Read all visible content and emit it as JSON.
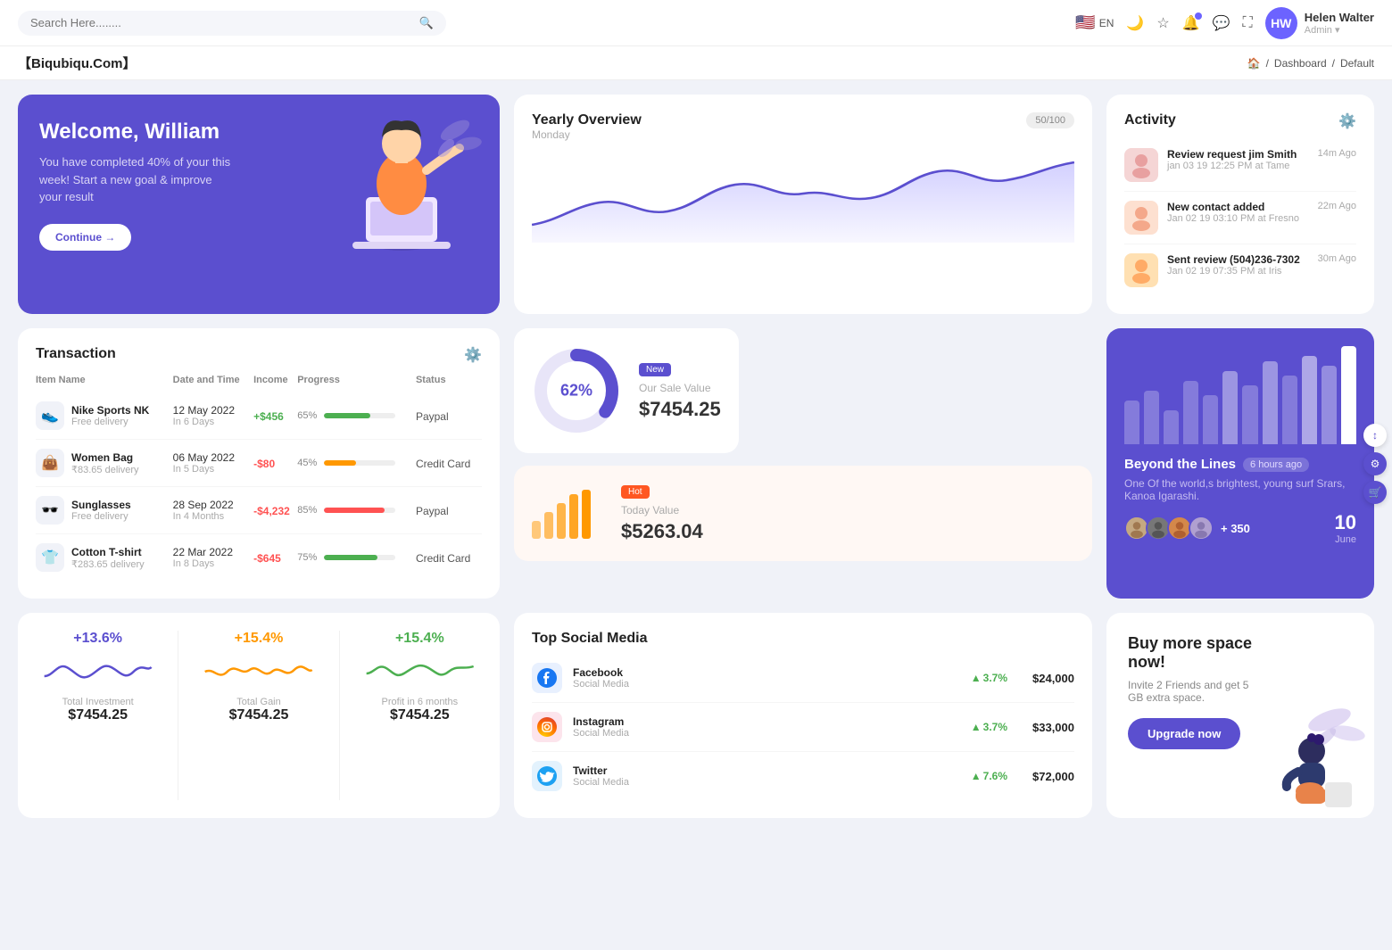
{
  "header": {
    "search_placeholder": "Search Here........",
    "lang": "EN",
    "user": {
      "name": "Helen Walter",
      "role": "Admin",
      "initials": "HW"
    },
    "icons": [
      "flag",
      "moon",
      "star",
      "bell",
      "chat",
      "fullscreen"
    ]
  },
  "breadcrumb": {
    "brand": "【Biqubiqu.Com】",
    "home": "⌂",
    "items": [
      "Dashboard",
      "Default"
    ]
  },
  "welcome": {
    "title": "Welcome, William",
    "description": "You have completed 40% of your this week! Start a new goal & improve your result",
    "button": "Continue →"
  },
  "yearly_overview": {
    "title": "Yearly Overview",
    "subtitle": "Monday",
    "badge": "50/100"
  },
  "activity": {
    "title": "Activity",
    "items": [
      {
        "title": "Review request jim Smith",
        "sub": "jan 03 19 12:25 PM at Tame",
        "time": "14m Ago"
      },
      {
        "title": "New contact added",
        "sub": "Jan 02 19 03:10 PM at Fresno",
        "time": "22m Ago"
      },
      {
        "title": "Sent review (504)236-7302",
        "sub": "Jan 02 19 07:35 PM at Iris",
        "time": "30m Ago"
      }
    ]
  },
  "transaction": {
    "title": "Transaction",
    "headers": [
      "Item Name",
      "Date and Time",
      "Income",
      "Progress",
      "Status"
    ],
    "rows": [
      {
        "icon": "👟",
        "name": "Nike Sports NK",
        "sub": "Free delivery",
        "date": "12 May 2022",
        "days": "In 6 Days",
        "income": "+$456",
        "income_type": "pos",
        "progress": 65,
        "progress_color": "#4caf50",
        "status": "Paypal"
      },
      {
        "icon": "👜",
        "name": "Women Bag",
        "sub": "₹83.65 delivery",
        "date": "06 May 2022",
        "days": "In 5 Days",
        "income": "-$80",
        "income_type": "neg",
        "progress": 45,
        "progress_color": "#ff9800",
        "status": "Credit Card"
      },
      {
        "icon": "🕶️",
        "name": "Sunglasses",
        "sub": "Free delivery",
        "date": "28 Sep 2022",
        "days": "In 4 Months",
        "income": "-$4,232",
        "income_type": "neg",
        "progress": 85,
        "progress_color": "#ff5252",
        "status": "Paypal"
      },
      {
        "icon": "👕",
        "name": "Cotton T-shirt",
        "sub": "₹283.65 delivery",
        "date": "22 Mar 2022",
        "days": "In 8 Days",
        "income": "-$645",
        "income_type": "neg",
        "progress": 75,
        "progress_color": "#4caf50",
        "status": "Credit Card"
      }
    ]
  },
  "sale": {
    "badge": "New",
    "percent": "62%",
    "label": "Our Sale Value",
    "value": "$7454.25"
  },
  "today": {
    "badge": "Hot",
    "label": "Today Value",
    "value": "$5263.04"
  },
  "beyond": {
    "title": "Beyond the Lines",
    "time": "6 hours ago",
    "desc": "One Of the world,s brightest, young surf Srars, Kanoa Igarashi.",
    "plus_count": "+ 350",
    "date": "10",
    "month": "June"
  },
  "stats": [
    {
      "percent": "+13.6%",
      "color": "blue",
      "label": "Total Investment",
      "value": "$7454.25"
    },
    {
      "percent": "+15.4%",
      "color": "orange",
      "label": "Total Gain",
      "value": "$7454.25"
    },
    {
      "percent": "+15.4%",
      "color": "green",
      "label": "Profit in 6 months",
      "value": "$7454.25"
    }
  ],
  "social_media": {
    "title": "Top Social Media",
    "items": [
      {
        "name": "Facebook",
        "sub": "Social Media",
        "icon": "f",
        "bg": "#1877f2",
        "pct": "3.7%",
        "amount": "$24,000"
      },
      {
        "name": "Instagram",
        "sub": "Social Media",
        "icon": "📷",
        "bg": "#e1306c",
        "pct": "3.7%",
        "amount": "$33,000"
      },
      {
        "name": "Twitter",
        "sub": "Social Media",
        "icon": "t",
        "bg": "#1da1f2",
        "pct": "7.6%",
        "amount": "$72,000"
      }
    ]
  },
  "promo": {
    "title": "Buy more space now!",
    "desc": "Invite 2 Friends and get 5 GB extra space.",
    "button": "Upgrade now"
  }
}
